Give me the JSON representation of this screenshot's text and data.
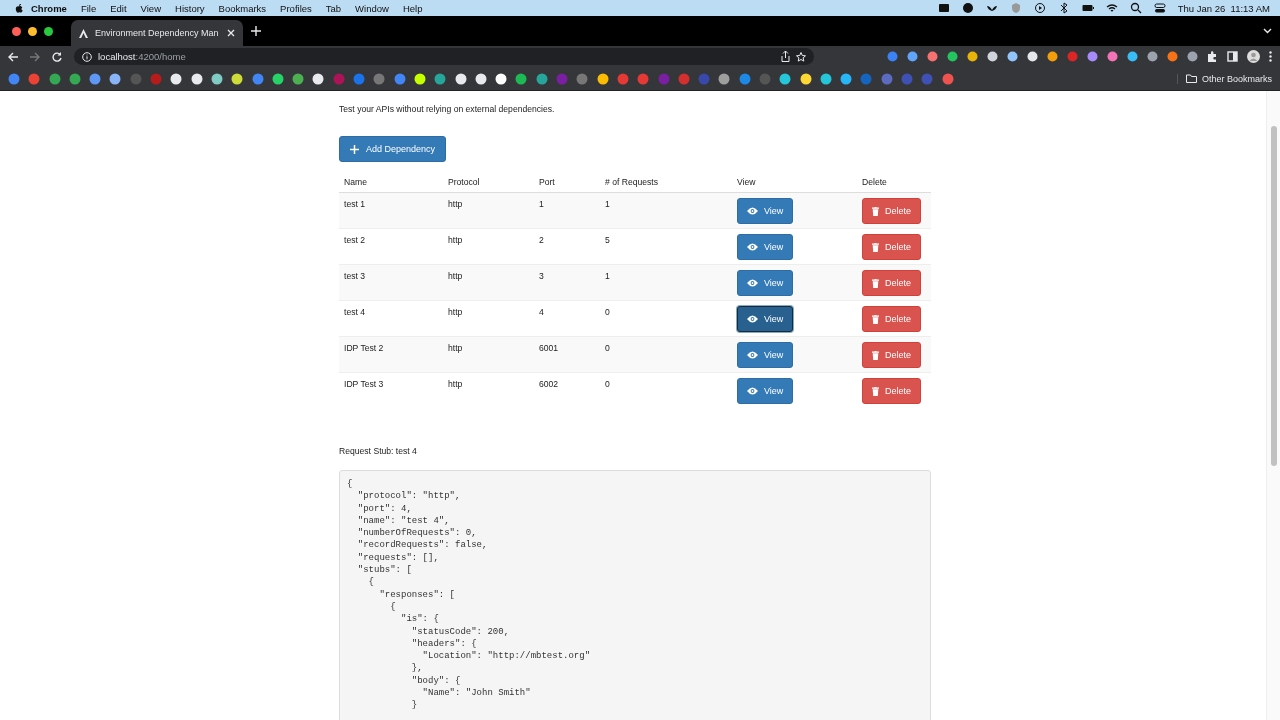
{
  "menu_bar": {
    "app": "Chrome",
    "items": [
      "File",
      "Edit",
      "View",
      "History",
      "Bookmarks",
      "Profiles",
      "Tab",
      "Window",
      "Help"
    ],
    "date": "Thu Jan 26",
    "time": "11:13 AM"
  },
  "browser": {
    "tab_title": "Environment Dependency Man",
    "url_host": "localhost",
    "url_path": ":4200/home",
    "other_bookmarks": "Other Bookmarks"
  },
  "page": {
    "subtitle": "Test your APIs without relying on external dependencies.",
    "add_button": "Add Dependency",
    "table": {
      "columns": [
        "Name",
        "Protocol",
        "Port",
        "# of Requests",
        "View",
        "Delete"
      ],
      "rows": [
        {
          "name": "test 1",
          "protocol": "http",
          "port": "1",
          "requests": "1",
          "view": "View",
          "delete": "Delete",
          "view_focused": false
        },
        {
          "name": "test 2",
          "protocol": "http",
          "port": "2",
          "requests": "5",
          "view": "View",
          "delete": "Delete",
          "view_focused": false
        },
        {
          "name": "test 3",
          "protocol": "http",
          "port": "3",
          "requests": "1",
          "view": "View",
          "delete": "Delete",
          "view_focused": false
        },
        {
          "name": "test 4",
          "protocol": "http",
          "port": "4",
          "requests": "0",
          "view": "View",
          "delete": "Delete",
          "view_focused": true
        },
        {
          "name": "IDP Test 2",
          "protocol": "http",
          "port": "6001",
          "requests": "0",
          "view": "View",
          "delete": "Delete",
          "view_focused": false
        },
        {
          "name": "IDP Test 3",
          "protocol": "http",
          "port": "6002",
          "requests": "0",
          "view": "View",
          "delete": "Delete",
          "view_focused": false
        }
      ]
    },
    "stub_title": "Request Stub: test 4",
    "stub_lines": [
      "{",
      "  \"protocol\": \"http\",",
      "  \"port\": 4,",
      "  \"name\": \"test 4\",",
      "  \"numberOfRequests\": 0,",
      "  \"recordRequests\": false,",
      "  \"requests\": [],",
      "  \"stubs\": [",
      "    {",
      "      \"responses\": [",
      "        {",
      "          \"is\": {",
      "            \"statusCode\": 200,",
      "            \"headers\": {",
      "              \"Location\": \"http://mbtest.org\"",
      "            },",
      "            \"body\": {",
      "              \"Name\": \"John Smith\"",
      "            }"
    ]
  }
}
